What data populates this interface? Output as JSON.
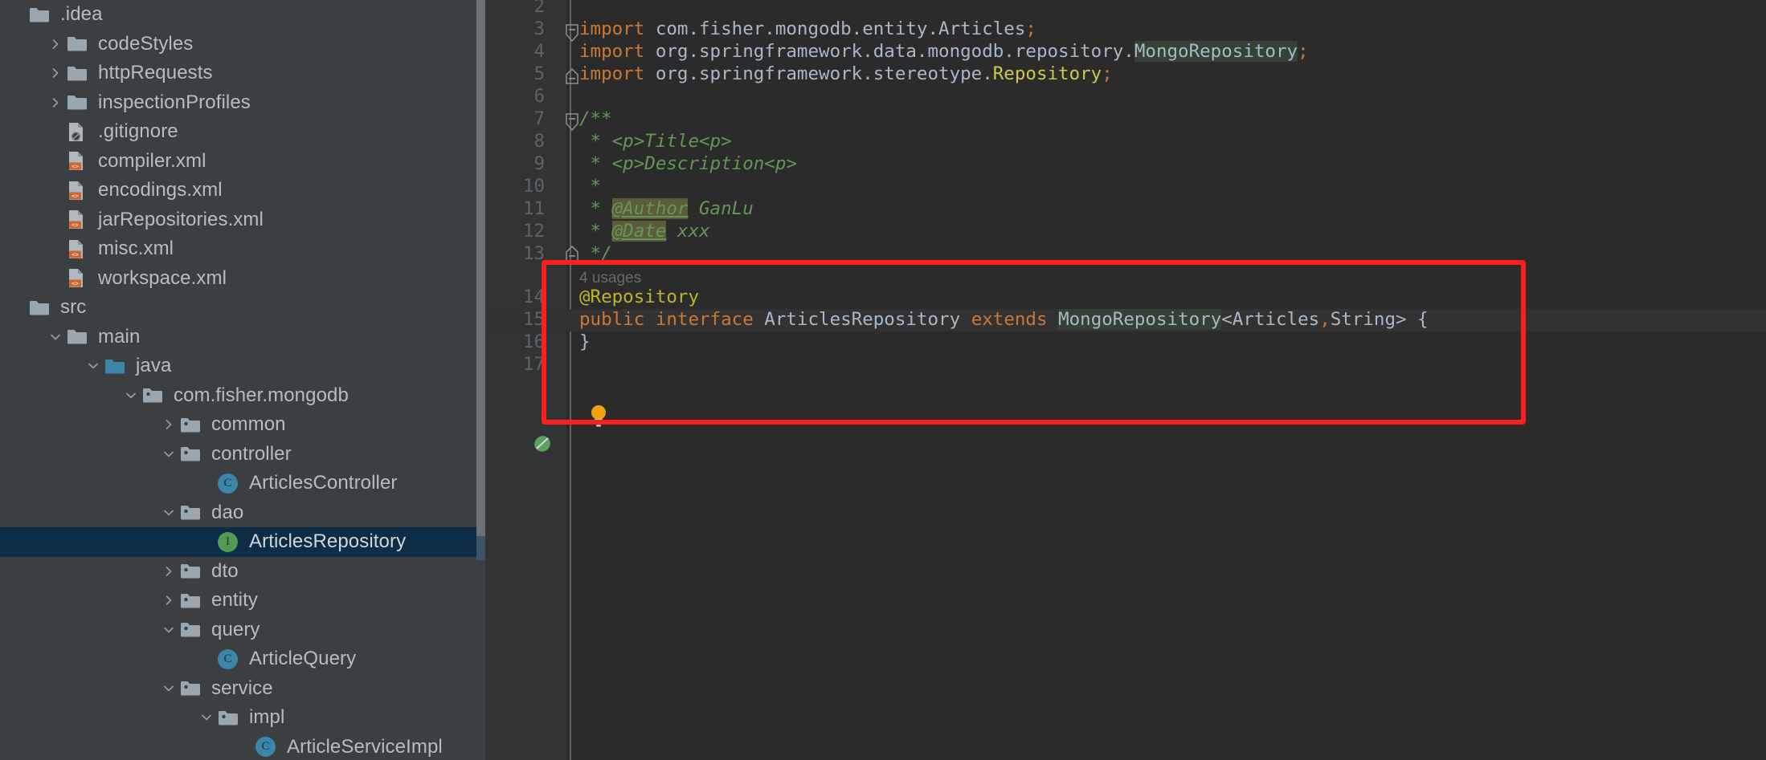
{
  "sidebar": {
    "name": "project-tool-window",
    "scrollbar": {
      "name": "sidebar-scrollbar"
    },
    "items": [
      {
        "label": ".idea",
        "indent": 0,
        "twisty": "none",
        "icon": "folder-icon",
        "selected": false
      },
      {
        "label": "codeStyles",
        "indent": 1,
        "twisty": "collapsed",
        "icon": "folder-icon",
        "selected": false
      },
      {
        "label": "httpRequests",
        "indent": 1,
        "twisty": "collapsed",
        "icon": "folder-icon",
        "selected": false
      },
      {
        "label": "inspectionProfiles",
        "indent": 1,
        "twisty": "collapsed",
        "icon": "folder-icon",
        "selected": false
      },
      {
        "label": ".gitignore",
        "indent": 1,
        "twisty": "none",
        "icon": "gitignore-file-icon",
        "selected": false
      },
      {
        "label": "compiler.xml",
        "indent": 1,
        "twisty": "none",
        "icon": "xml-file-icon",
        "selected": false
      },
      {
        "label": "encodings.xml",
        "indent": 1,
        "twisty": "none",
        "icon": "xml-file-icon",
        "selected": false
      },
      {
        "label": "jarRepositories.xml",
        "indent": 1,
        "twisty": "none",
        "icon": "xml-file-icon",
        "selected": false
      },
      {
        "label": "misc.xml",
        "indent": 1,
        "twisty": "none",
        "icon": "xml-file-icon",
        "selected": false
      },
      {
        "label": "workspace.xml",
        "indent": 1,
        "twisty": "none",
        "icon": "xml-file-icon",
        "selected": false
      },
      {
        "label": "src",
        "indent": 0,
        "twisty": "none",
        "icon": "folder-icon",
        "selected": false
      },
      {
        "label": "main",
        "indent": 1,
        "twisty": "expanded",
        "icon": "folder-icon",
        "selected": false
      },
      {
        "label": "java",
        "indent": 2,
        "twisty": "expanded",
        "icon": "source-root-icon",
        "selected": false
      },
      {
        "label": "com.fisher.mongodb",
        "indent": 3,
        "twisty": "expanded",
        "icon": "package-icon",
        "selected": false
      },
      {
        "label": "common",
        "indent": 4,
        "twisty": "collapsed",
        "icon": "package-icon",
        "selected": false
      },
      {
        "label": "controller",
        "indent": 4,
        "twisty": "expanded",
        "icon": "package-icon",
        "selected": false
      },
      {
        "label": "ArticlesController",
        "indent": 5,
        "twisty": "none",
        "icon": "java-class-icon",
        "selected": false
      },
      {
        "label": "dao",
        "indent": 4,
        "twisty": "expanded",
        "icon": "package-icon",
        "selected": false
      },
      {
        "label": "ArticlesRepository",
        "indent": 5,
        "twisty": "none",
        "icon": "java-interface-icon",
        "selected": true
      },
      {
        "label": "dto",
        "indent": 4,
        "twisty": "collapsed",
        "icon": "package-icon",
        "selected": false
      },
      {
        "label": "entity",
        "indent": 4,
        "twisty": "collapsed",
        "icon": "package-icon",
        "selected": false
      },
      {
        "label": "query",
        "indent": 4,
        "twisty": "expanded",
        "icon": "package-icon",
        "selected": false
      },
      {
        "label": "ArticleQuery",
        "indent": 5,
        "twisty": "none",
        "icon": "java-class-icon",
        "selected": false
      },
      {
        "label": "service",
        "indent": 4,
        "twisty": "expanded",
        "icon": "package-icon",
        "selected": false
      },
      {
        "label": "impl",
        "indent": 5,
        "twisty": "expanded",
        "icon": "package-icon",
        "selected": false
      },
      {
        "label": "ArticleServiceImpl",
        "indent": 6,
        "twisty": "none",
        "icon": "java-class-icon",
        "selected": false
      }
    ]
  },
  "editor": {
    "name": "code-editor",
    "caret_line": 15,
    "inlay_hint": {
      "line": 14,
      "text": "4 usages"
    },
    "gutter_icons": [
      {
        "line": 15,
        "name": "spring-bean-leaf-icon"
      }
    ],
    "intention_bulb": {
      "name": "intention-bulb-icon",
      "line": 14
    },
    "lines": [
      {
        "num": "2",
        "text": ""
      },
      {
        "num": "3",
        "text": "import com.fisher.mongodb.entity.Articles;"
      },
      {
        "num": "4",
        "text": "import org.springframework.data.mongodb.repository.MongoRepository;"
      },
      {
        "num": "5",
        "text": "import org.springframework.stereotype.Repository;"
      },
      {
        "num": "6",
        "text": ""
      },
      {
        "num": "7",
        "text": "/**"
      },
      {
        "num": "8",
        "text": " * <p>Title<p>"
      },
      {
        "num": "9",
        "text": " * <p>Description<p>"
      },
      {
        "num": "10",
        "text": " *"
      },
      {
        "num": "11",
        "text": " * @Author GanLu"
      },
      {
        "num": "12",
        "text": " * @Date xxx"
      },
      {
        "num": "13",
        "text": " */"
      },
      {
        "num": "14",
        "text": "@Repository"
      },
      {
        "num": "15",
        "text": "public interface ArticlesRepository extends MongoRepository<Articles,String> {"
      },
      {
        "num": "16",
        "text": "}"
      },
      {
        "num": "17",
        "text": ""
      }
    ]
  },
  "annotation": {
    "name": "red-highlight-rectangle",
    "color": "#fb1f1f"
  },
  "colors": {
    "editor_bg": "#2b2b2b",
    "gutter_bg": "#313335",
    "sidebar_bg": "#3c3f41",
    "selection_bg": "#0d2c46",
    "keyword": "#cc7832",
    "comment": "#629755",
    "annotation": "#bbb529",
    "identifier": "#a9b7c6",
    "highlight_ident_bg": "#344134"
  }
}
